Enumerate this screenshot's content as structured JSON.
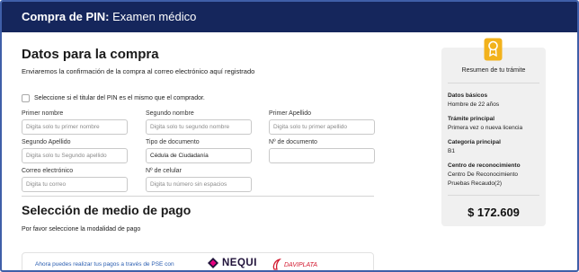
{
  "header": {
    "title_bold": "Compra de PIN:",
    "title_rest": " Examen médico"
  },
  "purchase": {
    "heading": "Datos para la compra",
    "subtitle": "Enviaremos la confirmación de la compra al correo electrónico aquí registrado",
    "checkbox_label": "Seleccione si el titular del PIN es el mismo que el comprador.",
    "fields": {
      "primer_nombre": {
        "label": "Primer nombre",
        "placeholder": "Digita solo tu primer nombre"
      },
      "segundo_nombre": {
        "label": "Segundo nombre",
        "placeholder": "Digita solo tu segundo nombre"
      },
      "primer_apellido": {
        "label": "Primer Apellido",
        "placeholder": "Digita solo tu primer apellido"
      },
      "segundo_apellido": {
        "label": "Segundo Apellido",
        "placeholder": "Digita solo tu Segundo apellido"
      },
      "tipo_documento": {
        "label": "Tipo de documento",
        "value": "Cédula de Ciudadanía"
      },
      "numero_documento": {
        "label": "Nº de documento",
        "placeholder": ""
      },
      "correo": {
        "label": "Correo electrónico",
        "placeholder": "Digita tu correo"
      },
      "celular": {
        "label": "Nº de celular",
        "placeholder": "Digita tu número sin espacios"
      }
    }
  },
  "payment": {
    "heading": "Selección de medio de pago",
    "subtitle": "Por favor seleccione la modalidad de pago",
    "pse_text": "Ahora puedes realizar tus pagos a través de PSE con",
    "nequi": "NEQUI",
    "daviplata": "DAVIPLATA"
  },
  "summary": {
    "title": "Resumen de tu trámite",
    "items": [
      {
        "label": "Datos básicos",
        "value": "Hombre de 22 años"
      },
      {
        "label": "Trámite principal",
        "value": "Primera vez o nueva licencia"
      },
      {
        "label": "Categoría principal",
        "value": "B1"
      },
      {
        "label": "Centro de reconocimiento",
        "value": "Centro De Reconocimiento",
        "value2": "Pruebas Recaudo(2)"
      }
    ],
    "price": "$ 172.609",
    "icon": "certificate-badge-icon",
    "accent_color": "#f2b21c"
  },
  "colors": {
    "header_bg": "#15265c",
    "link": "#2a5db0",
    "nequi": "#20123a",
    "daviplata": "#d2192f"
  }
}
